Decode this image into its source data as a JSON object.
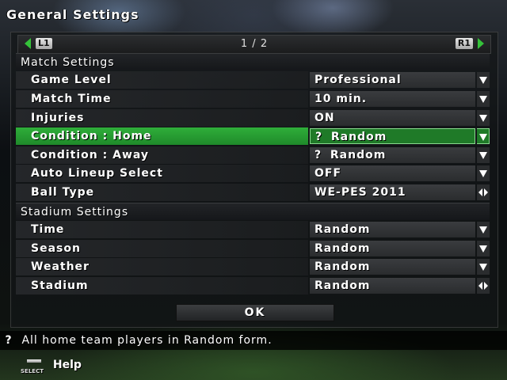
{
  "title": "General Settings",
  "pager": {
    "left_button": "L1",
    "right_button": "R1",
    "page": "1 / 2"
  },
  "match_section": {
    "title": "Match Settings",
    "rows": [
      {
        "label": "Game Level",
        "value": "Professional",
        "control": "dropdown"
      },
      {
        "label": "Match Time",
        "value": "10 min.",
        "control": "dropdown"
      },
      {
        "label": "Injuries",
        "value": "ON",
        "control": "dropdown"
      },
      {
        "label": "Condition : Home",
        "value": "Random",
        "value_icon": "?",
        "control": "dropdown"
      },
      {
        "label": "Condition : Away",
        "value": "Random",
        "value_icon": "?",
        "control": "dropdown"
      },
      {
        "label": "Auto Lineup Select",
        "value": "OFF",
        "control": "dropdown"
      },
      {
        "label": "Ball Type",
        "value": "WE-PES 2011",
        "control": "left-right"
      }
    ]
  },
  "stadium_section": {
    "title": "Stadium Settings",
    "rows": [
      {
        "label": "Time",
        "value": "Random",
        "control": "dropdown"
      },
      {
        "label": "Season",
        "value": "Random",
        "control": "dropdown"
      },
      {
        "label": "Weather",
        "value": "Random",
        "control": "dropdown"
      },
      {
        "label": "Stadium",
        "value": "Random",
        "control": "left-right"
      }
    ]
  },
  "ok_label": "OK",
  "help": {
    "icon": "?",
    "text": "All home team players in Random form."
  },
  "footer": {
    "button": "SELECT",
    "label": "Help"
  },
  "colors": {
    "highlight": "#2fae3a",
    "accent_arrow": "#35c23a"
  }
}
